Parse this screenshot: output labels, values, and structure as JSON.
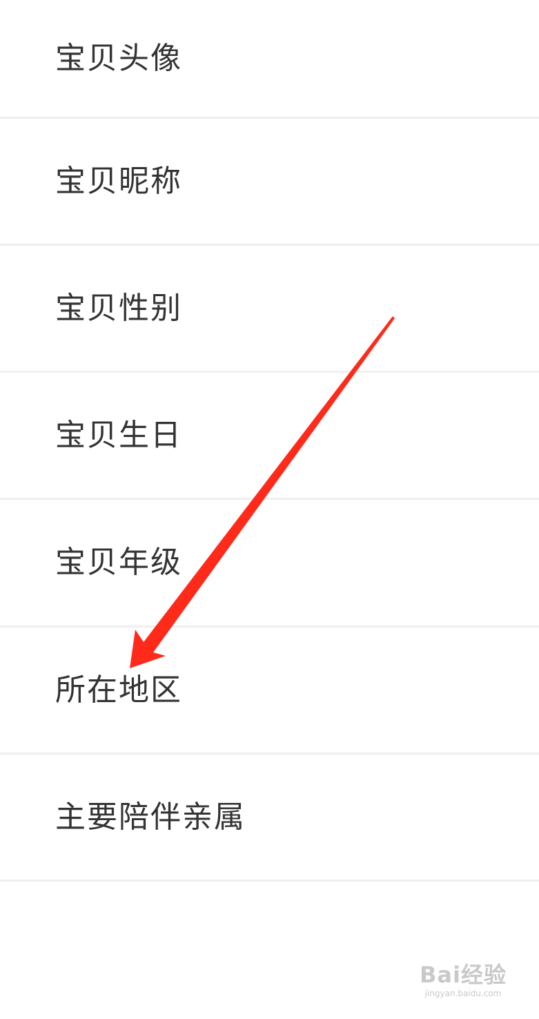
{
  "settings_list": {
    "items": [
      {
        "label": "宝贝头像"
      },
      {
        "label": "宝贝昵称"
      },
      {
        "label": "宝贝性别"
      },
      {
        "label": "宝贝生日"
      },
      {
        "label": "宝贝年级"
      },
      {
        "label": "所在地区"
      },
      {
        "label": "主要陪伴亲属"
      }
    ]
  },
  "annotation": {
    "arrow_color": "#ff2a1a",
    "points_to": "所在地区"
  },
  "watermark": {
    "logo": "Bai经验",
    "url": "jingyan.baidu.com"
  }
}
